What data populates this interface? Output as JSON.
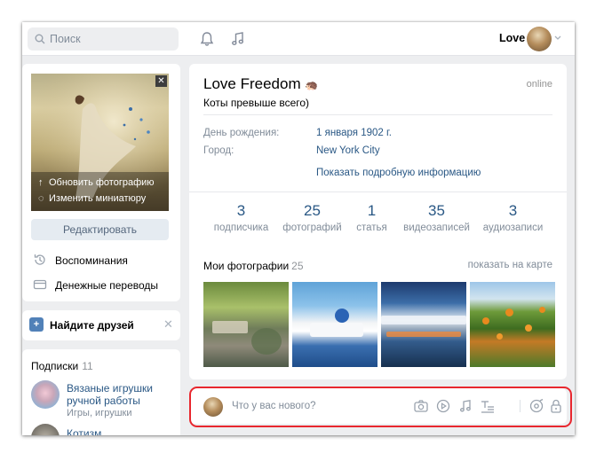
{
  "header": {
    "search_placeholder": "Поиск",
    "user_name": "Love"
  },
  "sidebar": {
    "overlay_upload": "Обновить фотографию",
    "overlay_thumb": "Изменить миниатюру",
    "close_glyph": "✕",
    "edit_button": "Редактировать",
    "menu": [
      {
        "label": "Воспоминания",
        "icon": "history-icon"
      },
      {
        "label": "Денежные переводы",
        "icon": "money-transfer-icon"
      }
    ],
    "find_friends": "Найдите друзей",
    "subscriptions": {
      "title": "Подписки",
      "count": "11",
      "items": [
        {
          "name": "Вязаные игрушки ручной работы",
          "subtitle": "Игры, игрушки"
        },
        {
          "name": "Котизм",
          "subtitle": ""
        }
      ]
    }
  },
  "profile": {
    "name": "Love Freedom",
    "status": "Коты превыше всего)",
    "online": "online",
    "fields": [
      {
        "label": "День рождения:",
        "value": "1 января 1902 г."
      },
      {
        "label": "Город:",
        "value": "New York City"
      }
    ],
    "more_info": "Показать подробную информацию",
    "counters": [
      {
        "num": "3",
        "label": "подписчика"
      },
      {
        "num": "25",
        "label": "фотографий"
      },
      {
        "num": "1",
        "label": "статья"
      },
      {
        "num": "35",
        "label": "видеозаписей"
      },
      {
        "num": "3",
        "label": "аудиозаписи"
      }
    ]
  },
  "photos": {
    "title": "Мои фотографии",
    "count": "25",
    "map_link": "показать на карте"
  },
  "post_box": {
    "placeholder": "Что у вас нового?"
  },
  "colors": {
    "link": "#2a5885",
    "accent": "#5181b8",
    "highlight": "#e8272e"
  }
}
